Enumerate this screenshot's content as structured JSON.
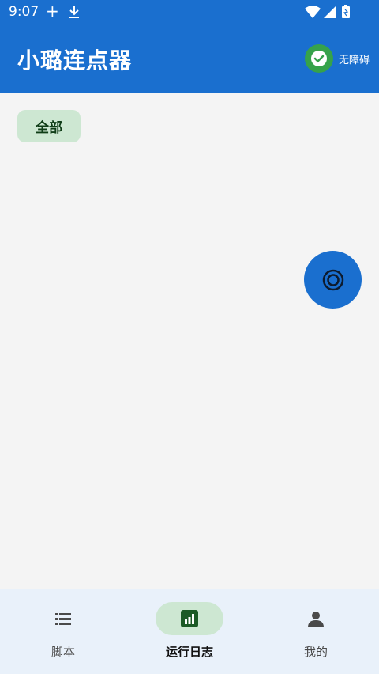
{
  "status_bar": {
    "time": "9:07",
    "plus_glyph": "+",
    "icons": [
      "plus-icon",
      "download-icon",
      "wifi-icon",
      "signal-icon",
      "battery-icon"
    ]
  },
  "app_bar": {
    "title": "小璐连点器",
    "accessibility_label": "无障碍",
    "accessibility_icon": "check-circle-icon"
  },
  "filter": {
    "chip_label": "全部"
  },
  "fab": {
    "icon": "target-icon"
  },
  "bottom_nav": {
    "items": [
      {
        "label": "脚本",
        "icon": "list-icon",
        "active": false
      },
      {
        "label": "运行日志",
        "icon": "bar-chart-icon",
        "active": true
      },
      {
        "label": "我的",
        "icon": "person-icon",
        "active": false
      }
    ]
  },
  "colors": {
    "primary": "#1a6fcf",
    "success": "#36a24a",
    "chip_bg": "#cde7d2",
    "chip_text": "#0f3d17",
    "background": "#f4f4f4",
    "nav_bg": "#e9f1fa"
  }
}
